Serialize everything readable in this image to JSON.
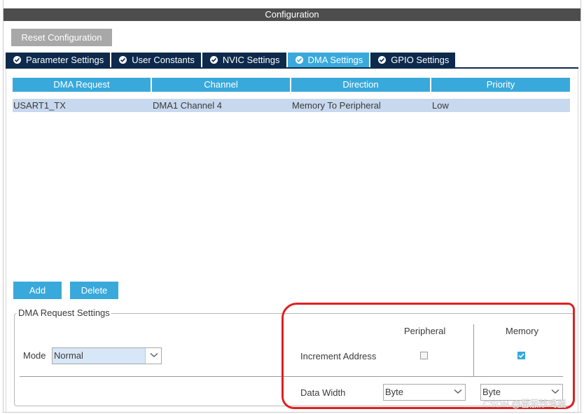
{
  "window": {
    "title": "Configuration"
  },
  "toolbar": {
    "reset_label": "Reset Configuration"
  },
  "tabs": [
    {
      "label": "Parameter Settings",
      "active": false
    },
    {
      "label": "User Constants",
      "active": false
    },
    {
      "label": "NVIC Settings",
      "active": false
    },
    {
      "label": "DMA Settings",
      "active": true
    },
    {
      "label": "GPIO Settings",
      "active": false
    }
  ],
  "dma_table": {
    "headers": [
      "DMA Request",
      "Channel",
      "Direction",
      "Priority"
    ],
    "rows": [
      [
        "USART1_TX",
        "DMA1 Channel 4",
        "Memory To Peripheral",
        "Low"
      ]
    ]
  },
  "actions": {
    "add_label": "Add",
    "delete_label": "Delete"
  },
  "request_settings": {
    "legend": "DMA Request Settings",
    "mode_label": "Mode",
    "mode_value": "Normal",
    "peripheral_header": "Peripheral",
    "memory_header": "Memory",
    "increment_label": "Increment Address",
    "peripheral_increment": false,
    "memory_increment": true,
    "data_width_label": "Data Width",
    "peripheral_width": "Byte",
    "memory_width": "Byte"
  },
  "watermark": "CSDN @番茄炒鸡蛋",
  "colors": {
    "accent": "#39a9dc",
    "tab_inactive": "#0d2a4c",
    "title_bar": "#4d4d4d",
    "highlight": "#e02020"
  }
}
